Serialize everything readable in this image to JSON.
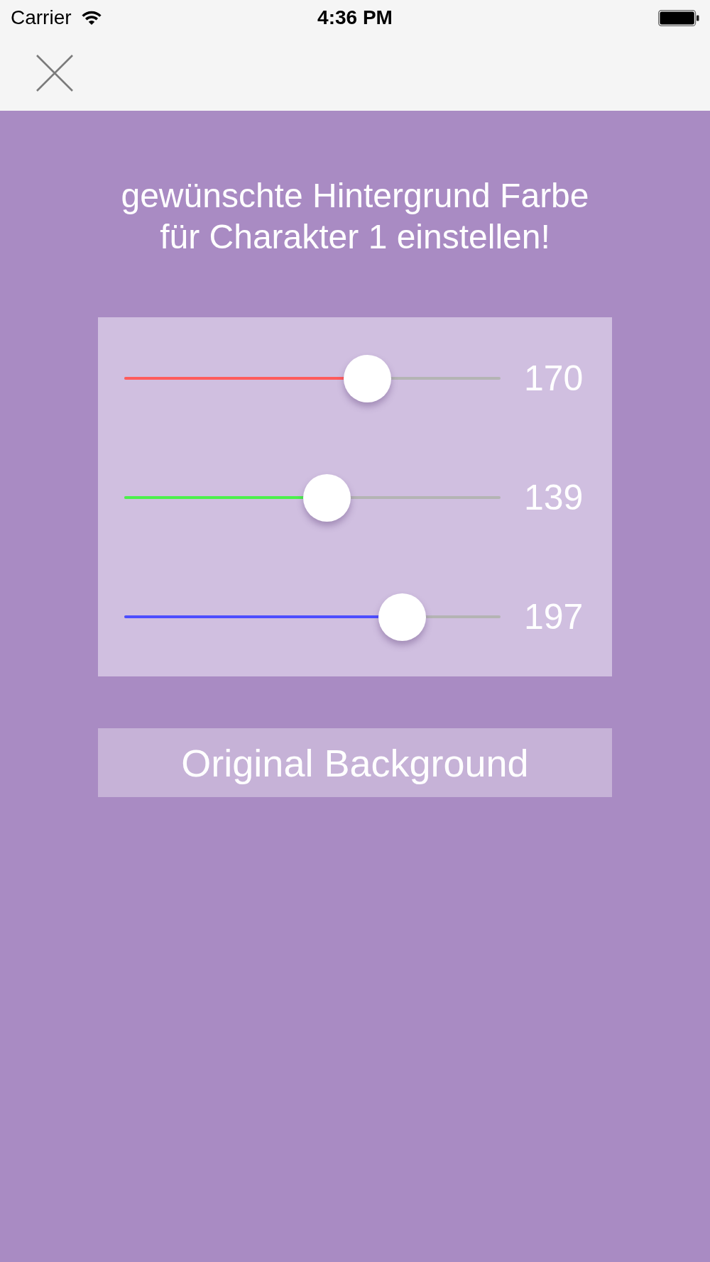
{
  "status_bar": {
    "carrier": "Carrier",
    "time": "4:36 PM"
  },
  "title": "gewünschte Hintergrund Farbe für Charakter 1 einstellen!",
  "sliders": [
    {
      "color": "#ff5c5c",
      "level": 0.667,
      "reading": "170"
    },
    {
      "color": "#4cf04c",
      "level": 0.545,
      "reading": "139"
    },
    {
      "color": "#4d4dff",
      "level": 0.773,
      "reading": "197"
    }
  ],
  "button": {
    "label": "Original Background"
  }
}
